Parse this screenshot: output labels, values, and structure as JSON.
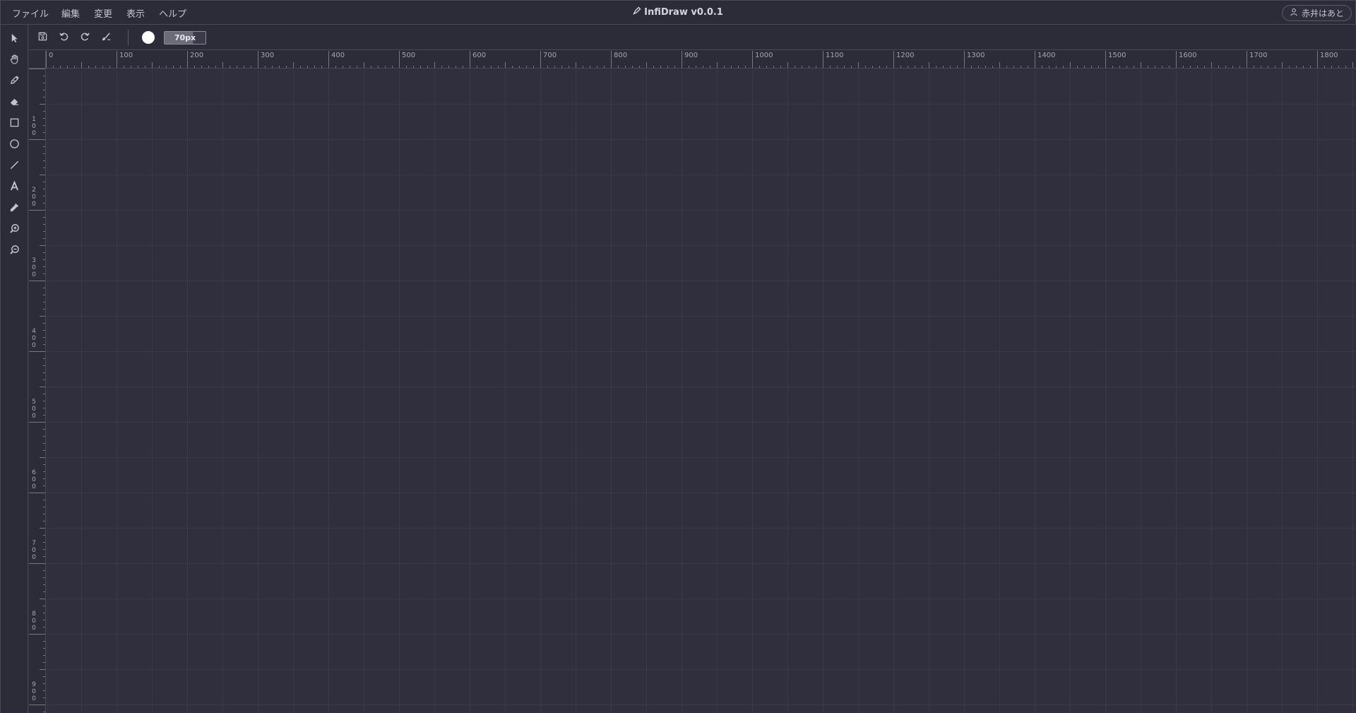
{
  "menu": {
    "items": [
      {
        "label": "ファイル",
        "name": "menu-file"
      },
      {
        "label": "編集",
        "name": "menu-edit"
      },
      {
        "label": "変更",
        "name": "menu-modify"
      },
      {
        "label": "表示",
        "name": "menu-view"
      },
      {
        "label": "ヘルプ",
        "name": "menu-help"
      }
    ]
  },
  "app": {
    "title": "InfiDraw v0.0.1",
    "logo_icon": "pen-nib-icon"
  },
  "user": {
    "name": "赤井はあと",
    "icon": "user-icon"
  },
  "tools": [
    {
      "name": "select-tool",
      "icon": "arrow-pointer-icon"
    },
    {
      "name": "hand-tool",
      "icon": "hand-icon"
    },
    {
      "name": "pen-tool",
      "icon": "pen-icon"
    },
    {
      "name": "eraser-tool",
      "icon": "eraser-icon"
    },
    {
      "name": "rectangle-tool",
      "icon": "rectangle-icon"
    },
    {
      "name": "ellipse-tool",
      "icon": "circle-icon"
    },
    {
      "name": "line-tool",
      "icon": "line-icon"
    },
    {
      "name": "text-tool",
      "icon": "text-icon"
    },
    {
      "name": "eyedropper-tool",
      "icon": "eyedropper-icon"
    },
    {
      "name": "zoom-in-tool",
      "icon": "zoom-in-icon"
    },
    {
      "name": "zoom-out-tool",
      "icon": "zoom-out-icon"
    }
  ],
  "actions": [
    {
      "name": "save-button",
      "icon": "save-icon"
    },
    {
      "name": "undo-button",
      "icon": "undo-icon"
    },
    {
      "name": "redo-button",
      "icon": "redo-icon"
    },
    {
      "name": "clear-brush-button",
      "icon": "brush-clear-icon"
    }
  ],
  "brush": {
    "color": "#ffffff",
    "size": "70px",
    "size_fill_fraction": 0.7
  },
  "rulers": {
    "top_labels": [
      "0",
      "100",
      "200",
      "300",
      "400",
      "500",
      "600",
      "700",
      "800",
      "900",
      "1000",
      "1100",
      "1200",
      "1300",
      "1400",
      "1500",
      "1600",
      "1700",
      "1800"
    ],
    "left_labels": [
      "100",
      "200",
      "300",
      "400",
      "500",
      "600",
      "700",
      "800",
      "900"
    ]
  },
  "theme": {
    "background": "#2f2e3c",
    "panel": "#2c2b38",
    "border": "#4a4958",
    "text": "#c4c3ce"
  }
}
